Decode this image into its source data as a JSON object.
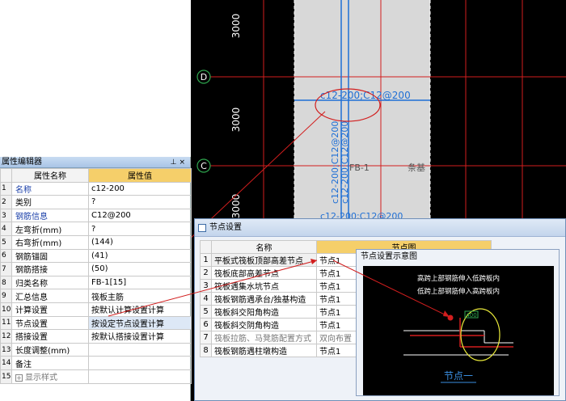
{
  "cad": {
    "dim_top": "3000",
    "dim_mid": "3000",
    "dim_bottom": "3000",
    "axis_d": "D",
    "axis_c": "C",
    "rebar_label": "c12-200;C12@200",
    "vert_rebar_1": "c12-200;C12@200",
    "vert_rebar_2": "c12-200;C12@200",
    "bottom_rebar": "c12-200;C12@200",
    "slab_label": "FB-1",
    "strip_label": "条基",
    "colors": {
      "background": "#000000",
      "grid": "#d21e1e",
      "rebar": "#1e6fd6",
      "slab": "#d8d8d8"
    }
  },
  "property_editor": {
    "title": "属性编辑器",
    "pin_icon": "pin-icon",
    "close_icon": "close-icon",
    "header_name": "属性名称",
    "header_value": "属性值",
    "rows": [
      {
        "num": "1",
        "name": "名称",
        "value": "c12-200",
        "style": "blue"
      },
      {
        "num": "2",
        "name": "类别",
        "value": "?",
        "style": ""
      },
      {
        "num": "3",
        "name": "钢筋信息",
        "value": "C12@200",
        "style": "blue"
      },
      {
        "num": "4",
        "name": "左弯折(mm)",
        "value": "?",
        "style": ""
      },
      {
        "num": "5",
        "name": "右弯折(mm)",
        "value": "(144)",
        "style": ""
      },
      {
        "num": "6",
        "name": "钢筋锚固",
        "value": "(41)",
        "style": ""
      },
      {
        "num": "7",
        "name": "钢筋搭接",
        "value": "(50)",
        "style": ""
      },
      {
        "num": "8",
        "name": "归类名称",
        "value": "FB-1[15]",
        "style": ""
      },
      {
        "num": "9",
        "name": "汇总信息",
        "value": "筏板主筋",
        "style": ""
      },
      {
        "num": "10",
        "name": "计算设置",
        "value": "按默认计算设置计算",
        "style": ""
      },
      {
        "num": "11",
        "name": "节点设置",
        "value": "按设定节点设置计算",
        "style": "",
        "selected": true
      },
      {
        "num": "12",
        "name": "搭接设置",
        "value": "按默认搭接设置计算",
        "style": ""
      },
      {
        "num": "13",
        "name": "长度调整(mm)",
        "value": "",
        "style": ""
      },
      {
        "num": "14",
        "name": "备注",
        "value": "",
        "style": ""
      },
      {
        "num": "15",
        "name": "显示样式",
        "value": "",
        "style": "gray",
        "expander": "+"
      }
    ]
  },
  "node_dialog": {
    "title": "节点设置",
    "header_name": "名称",
    "header_value": "节点图",
    "rows": [
      {
        "num": "1",
        "name": "平板式筏板顶部高差节点",
        "value": "节点1",
        "selected": true
      },
      {
        "num": "2",
        "name": "筏板底部高差节点",
        "value": "节点1"
      },
      {
        "num": "3",
        "name": "筏板遇集水坑节点",
        "value": "节点1"
      },
      {
        "num": "4",
        "name": "筏板钢筋遇承台/独基构造",
        "value": "节点1"
      },
      {
        "num": "5",
        "name": "筏板斜交阳角构造",
        "value": "节点1"
      },
      {
        "num": "6",
        "name": "筏板斜交阴角构造",
        "value": "节点1"
      },
      {
        "num": "7",
        "name": "筏板拉筋、马凳筋配置方式",
        "value": "双向布置",
        "gray": true
      },
      {
        "num": "8",
        "name": "筏板钢筋遇柱墩构造",
        "value": "节点1"
      }
    ]
  },
  "preview": {
    "title": "节点设置示意图",
    "line1": "高跨上部钢筋伸入低跨板内",
    "line2": "低跨上部钢筋伸入高跨板内",
    "dim": "400",
    "caption": "节点一"
  }
}
